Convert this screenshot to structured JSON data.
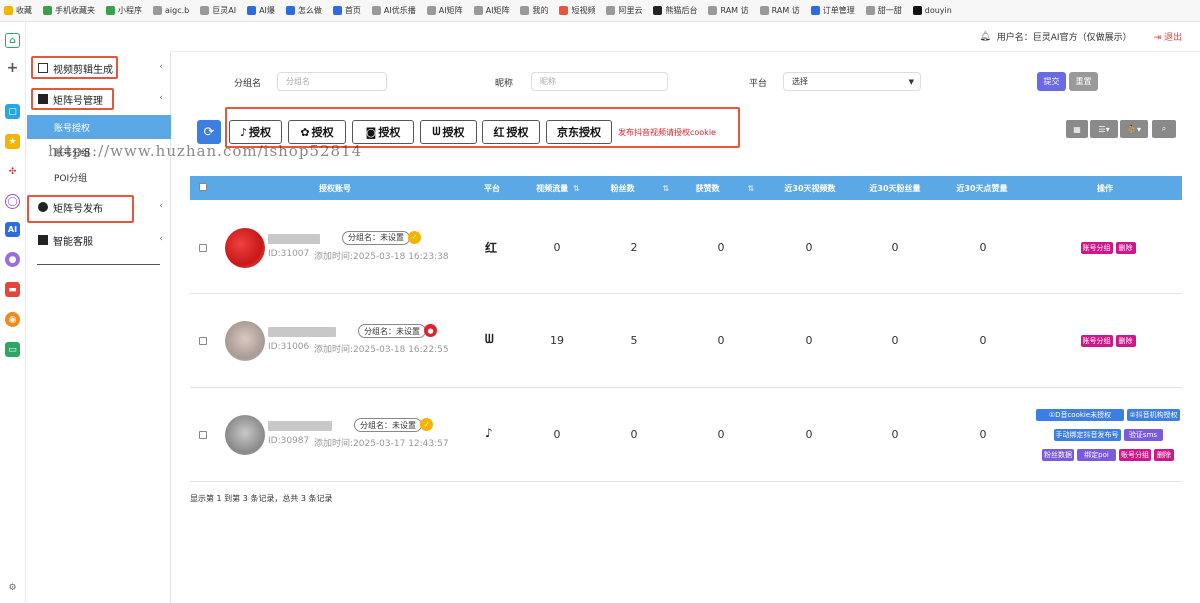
{
  "bookmarks": [
    {
      "label": "收藏",
      "color": "#f5b400"
    },
    {
      "label": "手机收藏夹",
      "color": "#3aa14a"
    },
    {
      "label": "小程序",
      "color": "#3aa14a"
    },
    {
      "label": "aigc.b",
      "color": "#999999"
    },
    {
      "label": "巨灵AI",
      "color": "#999999"
    },
    {
      "label": "AI爆",
      "color": "#2f6be0"
    },
    {
      "label": "怎么做",
      "color": "#2f6be0"
    },
    {
      "label": "首页",
      "color": "#2f6be0"
    },
    {
      "label": "AI优乐播",
      "color": "#999999"
    },
    {
      "label": "AI矩阵",
      "color": "#999999"
    },
    {
      "label": "AI矩阵",
      "color": "#999999"
    },
    {
      "label": "我的",
      "color": "#999999"
    },
    {
      "label": "短视频",
      "color": "#e8553a"
    },
    {
      "label": "阿里云",
      "color": "#999999"
    },
    {
      "label": "熊猫后台",
      "color": "#222222"
    },
    {
      "label": "RAM 访",
      "color": "#999999"
    },
    {
      "label": "RAM 访",
      "color": "#999999"
    },
    {
      "label": "订单管理",
      "color": "#2f6be0"
    },
    {
      "label": "甜一甜",
      "color": "#999999"
    },
    {
      "label": "douyin",
      "color": "#111111"
    }
  ],
  "header": {
    "user_label": "用户名：巨灵AI官方（仅做展示）",
    "logout": "退出"
  },
  "sidebar": {
    "video_edit": "视频剪辑生成",
    "matrix_manage": "矩阵号管理",
    "account_auth": "账号授权",
    "account_group": "账号分组",
    "poi_group": "POI分组",
    "matrix_publish": "矩阵号发布",
    "smart_service": "智能客服"
  },
  "filters": {
    "group_label": "分组名",
    "group_placeholder": "分组名",
    "nickname_label": "昵称",
    "nickname_placeholder": "昵称",
    "platform_label": "平台",
    "platform_value": "选择",
    "submit": "提交",
    "reset": "重置"
  },
  "auth_buttons": [
    {
      "icon": "♪",
      "label": "授权"
    },
    {
      "icon": "✿",
      "label": "授权"
    },
    {
      "icon": "◙",
      "label": "授权"
    },
    {
      "icon": "ᗯ",
      "label": "授权"
    },
    {
      "icon": "红",
      "label": "授权"
    },
    {
      "icon": "",
      "label": "京东授权"
    }
  ],
  "auth_hint": "发布抖音视频请授权cookie",
  "watermark": "https://www.huzhan.com/ishop52814",
  "table": {
    "headers": [
      "授权账号",
      "平台",
      "视频流量",
      "粉丝数",
      "获赞数",
      "近30天视频数",
      "近30天粉丝量",
      "近30天点赞量",
      "操作"
    ],
    "rows": [
      {
        "group": "分组名：未设置",
        "id": "ID:31007",
        "added": "添加时间:2025-03-18 16:23:38",
        "platform": "红",
        "video_traffic": "0",
        "fans": "2",
        "likes": "0",
        "v30": "0",
        "f30": "0",
        "l30": "0",
        "status_color": "#f5b400",
        "actions": [
          [
            "账号分组",
            "删除"
          ]
        ]
      },
      {
        "group": "分组名：未设置",
        "id": "ID:31006",
        "added": "添加时间:2025-03-18 16:22:55",
        "platform": "ᗯ",
        "video_traffic": "19",
        "fans": "5",
        "likes": "0",
        "v30": "0",
        "f30": "0",
        "l30": "0",
        "status_color": "#e5202a",
        "actions": [
          [
            "账号分组",
            "删除"
          ]
        ]
      },
      {
        "group": "分组名：未设置",
        "id": "ID:30987",
        "added": "添加时间:2025-03-17 12:43:57",
        "platform": "♪",
        "video_traffic": "0",
        "fans": "0",
        "likes": "0",
        "v30": "0",
        "f30": "0",
        "l30": "0",
        "status_color": "#f5b400",
        "actions": [
          [
            "①D音cookie未授权",
            "②抖音机构授权"
          ],
          [
            "手动绑定抖音发布号",
            "验证sms"
          ],
          [
            "粉丝数据",
            "绑定poi",
            "账号分组",
            "删除"
          ]
        ]
      }
    ]
  },
  "footer": "显示第 1 到第 3 条记录，总共 3 条记录",
  "colors": {
    "accent": "#5aa8e6",
    "badge_pink": "#d0178a",
    "badge_blue": "#3d7fe0",
    "badge_purple": "#7a5be0",
    "highlight_red": "#e8553a"
  }
}
